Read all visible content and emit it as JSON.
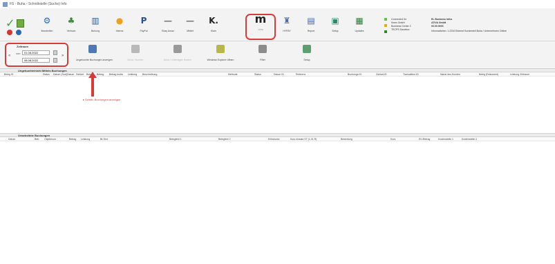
{
  "window": {
    "title": "FS - Buha - Schnittstelle (Suche) Info"
  },
  "toolbar": {
    "buttons": [
      {
        "label": "Bearbeiten",
        "icon": "gear-icon",
        "color": "#2d67b0"
      },
      {
        "label": "Verbuch",
        "icon": "tree-icon",
        "color": "#3b8d3b"
      },
      {
        "label": "Buhung",
        "icon": "building-icon",
        "color": "#2d5f9e"
      },
      {
        "label": "Interes",
        "icon": "coin-icon",
        "color": "#f0a020"
      },
      {
        "label": "PayPal",
        "icon": "paypal-icon",
        "color": "#1f4f9c"
      },
      {
        "label": "Ebay Amaz",
        "icon": "ebay-icon",
        "color": "#777777"
      },
      {
        "label": "Mfdiet",
        "icon": "dash-icon",
        "color": "#777777"
      },
      {
        "label": "Klarn",
        "icon": "klarna-icon",
        "color": "#222222"
      },
      {
        "label": "Lexw",
        "icon": "mollie-icon",
        "color": "#222222"
      },
      {
        "label": "HYPAY",
        "icon": "shop-icon",
        "color": "#4a6fa5"
      },
      {
        "label": "Report",
        "icon": "report-icon",
        "color": "#3b60b0"
      },
      {
        "label": "Setup",
        "icon": "tools-icon",
        "color": "#2b8a6a"
      },
      {
        "label": "Updates",
        "icon": "book-icon",
        "color": "#2f7a3a"
      }
    ]
  },
  "connection": {
    "status_colors": [
      "#6abf4b",
      "#e0b000",
      "#2c8a2c"
    ],
    "col1": [
      "Connected  Ihr",
      "Ihnen GmbH",
      "",
      "Business Center 2",
      "TECPS Sandbox"
    ],
    "col2": [
      "EL Business Infos",
      "ATIVA GmbH",
      "00.00.0000"
    ],
    "note": "Informationen: 1.2234 Erkennt Kundenteil Buha / Unternehmen Online"
  },
  "zeitraum": {
    "label": "Zeitraum",
    "from": "01.08.2022",
    "to": "08.08.2022"
  },
  "actions": [
    {
      "label": "Ungebuchte Buchungen anzeigen",
      "icon": "search-icon",
      "disabled": false
    },
    {
      "label": "Buha / Buchen",
      "icon": "ledger-icon",
      "disabled": true
    },
    {
      "label": "Buha / Unterlagen Bedien",
      "icon": "ledger-icon",
      "disabled": true
    },
    {
      "label": "Windows Explorer öffnen",
      "icon": "folder-icon",
      "disabled": false
    },
    {
      "label": "Filter",
      "icon": "filter-icon",
      "disabled": false
    },
    {
      "label": "Setup",
      "icon": "setup-icon",
      "disabled": false
    }
  ],
  "section1": {
    "title": "Ungebuchte/nicht Mittels Buchungen",
    "columns": [
      "Beleg ID",
      "Status",
      "Datum (Sort)",
      "Datum",
      "Zahlart",
      "Beleg",
      "Betrag",
      "Betrag brutto",
      "Leistung",
      "Beschreibung",
      "Methode",
      "Status",
      "Datum ID",
      "Referenz",
      "Buchungs ID",
      "Zahlart-ID",
      "Transaktion ID",
      "Name des Kunden",
      "Beleg (Dokument)",
      "Leistung Zeitraum"
    ]
  },
  "hint": "▸ Schritt: Buchungen anzeigen",
  "section2": {
    "title": "Verarbeitete Buchungen",
    "columns": [
      "Datum",
      "Betr.",
      "Objektnum",
      "Betrag",
      "Leistung",
      "Bt-Text",
      "Belegfeld 1",
      "Belegfeld 2",
      "Erlöskonto",
      "Kurs einsatz ST (1,01 R)",
      "Bewertung",
      "Kurs",
      "EU-Betrag",
      "Kostenstelle 1",
      "Kostenstelle 2"
    ]
  }
}
